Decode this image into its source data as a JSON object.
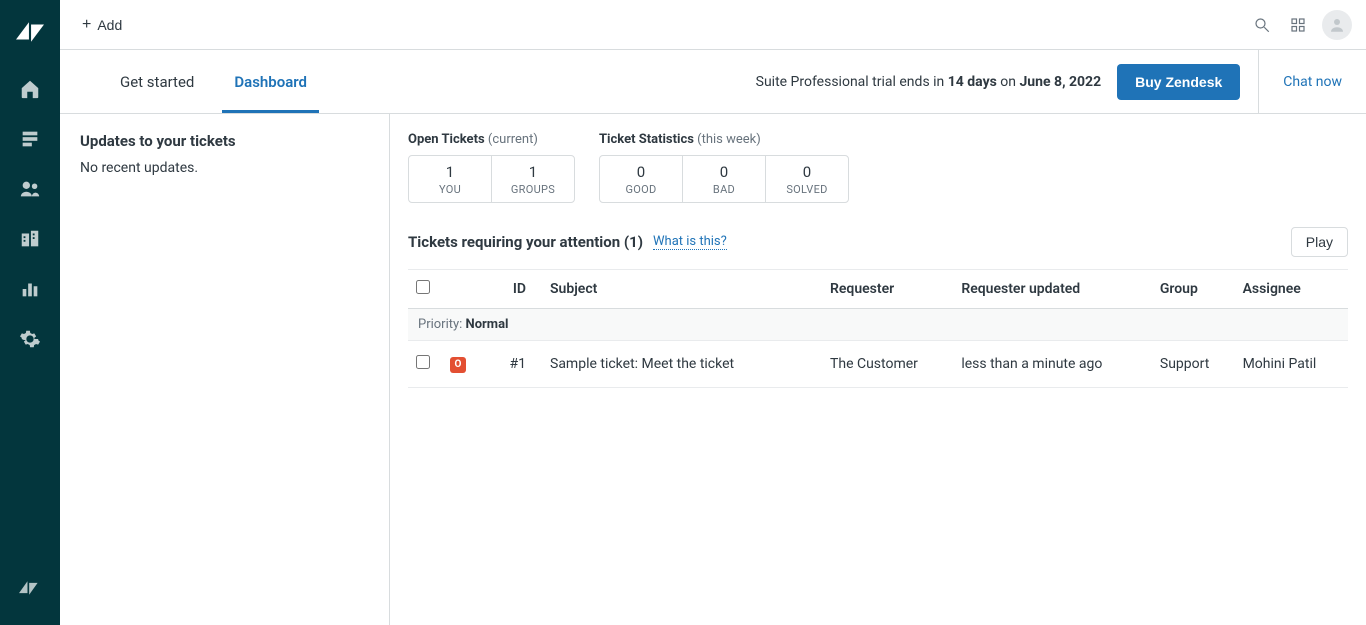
{
  "topbar": {
    "add_label": "Add"
  },
  "tabs": {
    "get_started": "Get started",
    "dashboard": "Dashboard"
  },
  "trial": {
    "prefix": "Suite Professional trial ends in ",
    "days": "14 days",
    "mid": " on ",
    "date": "June 8, 2022",
    "buy_label": "Buy Zendesk",
    "chat_label": "Chat now"
  },
  "updates": {
    "title": "Updates to your tickets",
    "empty": "No recent updates."
  },
  "stats": {
    "open": {
      "label": "Open Tickets",
      "suffix": "(current)",
      "boxes": [
        {
          "value": "1",
          "label": "YOU"
        },
        {
          "value": "1",
          "label": "GROUPS"
        }
      ]
    },
    "ticket_stats": {
      "label": "Ticket Statistics",
      "suffix": "(this week)",
      "boxes": [
        {
          "value": "0",
          "label": "GOOD"
        },
        {
          "value": "0",
          "label": "BAD"
        },
        {
          "value": "0",
          "label": "SOLVED"
        }
      ]
    }
  },
  "attention": {
    "title": "Tickets requiring your attention (1)",
    "what_is_this": "What is this?",
    "play_label": "Play"
  },
  "table": {
    "headers": {
      "id": "ID",
      "subject": "Subject",
      "requester": "Requester",
      "requester_updated": "Requester updated",
      "group": "Group",
      "assignee": "Assignee"
    },
    "priority_label": "Priority: ",
    "priority_value": "Normal",
    "rows": [
      {
        "status": "O",
        "id": "#1",
        "subject": "Sample ticket: Meet the ticket",
        "requester": "The Customer",
        "requester_updated": "less than a minute ago",
        "group": "Support",
        "assignee": "Mohini Patil"
      }
    ]
  }
}
